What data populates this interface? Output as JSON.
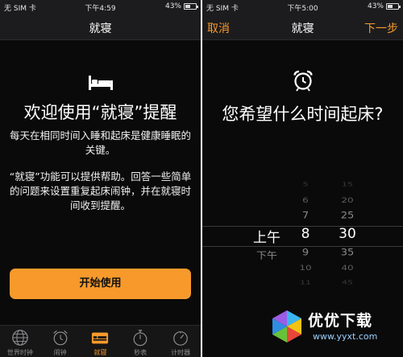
{
  "left": {
    "status": {
      "carrier": "无 SIM 卡",
      "time": "下午4:59",
      "battery": "43%"
    },
    "nav_title": "就寝",
    "welcome_title": "欢迎使用“就寝”提醒",
    "paragraph1": "每天在相同时间入睡和起床是健康睡眠的关键。",
    "paragraph2": "“就寝”功能可以提供帮助。回答一些简单的问题来设置重复起床闹钟，并在就寝时间收到提醒。",
    "start_button": "开始使用",
    "tabs": [
      {
        "label": "世界时钟",
        "icon": "globe-icon",
        "active": false
      },
      {
        "label": "闹钟",
        "icon": "alarm-icon",
        "active": false
      },
      {
        "label": "就寝",
        "icon": "bed-icon",
        "active": true
      },
      {
        "label": "秒表",
        "icon": "stopwatch-icon",
        "active": false
      },
      {
        "label": "计时器",
        "icon": "timer-icon",
        "active": false
      }
    ]
  },
  "right": {
    "status": {
      "carrier": "无 SIM 卡",
      "time": "下午5:00",
      "battery": "43%"
    },
    "nav": {
      "cancel": "取消",
      "title": "就寝",
      "next": "下一步"
    },
    "question": "您希望什么时间起床?",
    "picker": {
      "ampm": [
        "上午",
        "下午"
      ],
      "ampm_selected": "上午",
      "hours": [
        "5",
        "6",
        "7",
        "8",
        "9",
        "10",
        "11"
      ],
      "hour_selected": "8",
      "minutes": [
        "15",
        "20",
        "25",
        "30",
        "35",
        "40",
        "45"
      ],
      "minute_selected": "30"
    }
  },
  "watermark": {
    "text": "优优下载",
    "url": "www.yyxt.com"
  },
  "colors": {
    "accent": "#f79a2b",
    "background": "#0a0a0a",
    "bar": "#1c1c1e",
    "inactive": "#8e8e93"
  }
}
